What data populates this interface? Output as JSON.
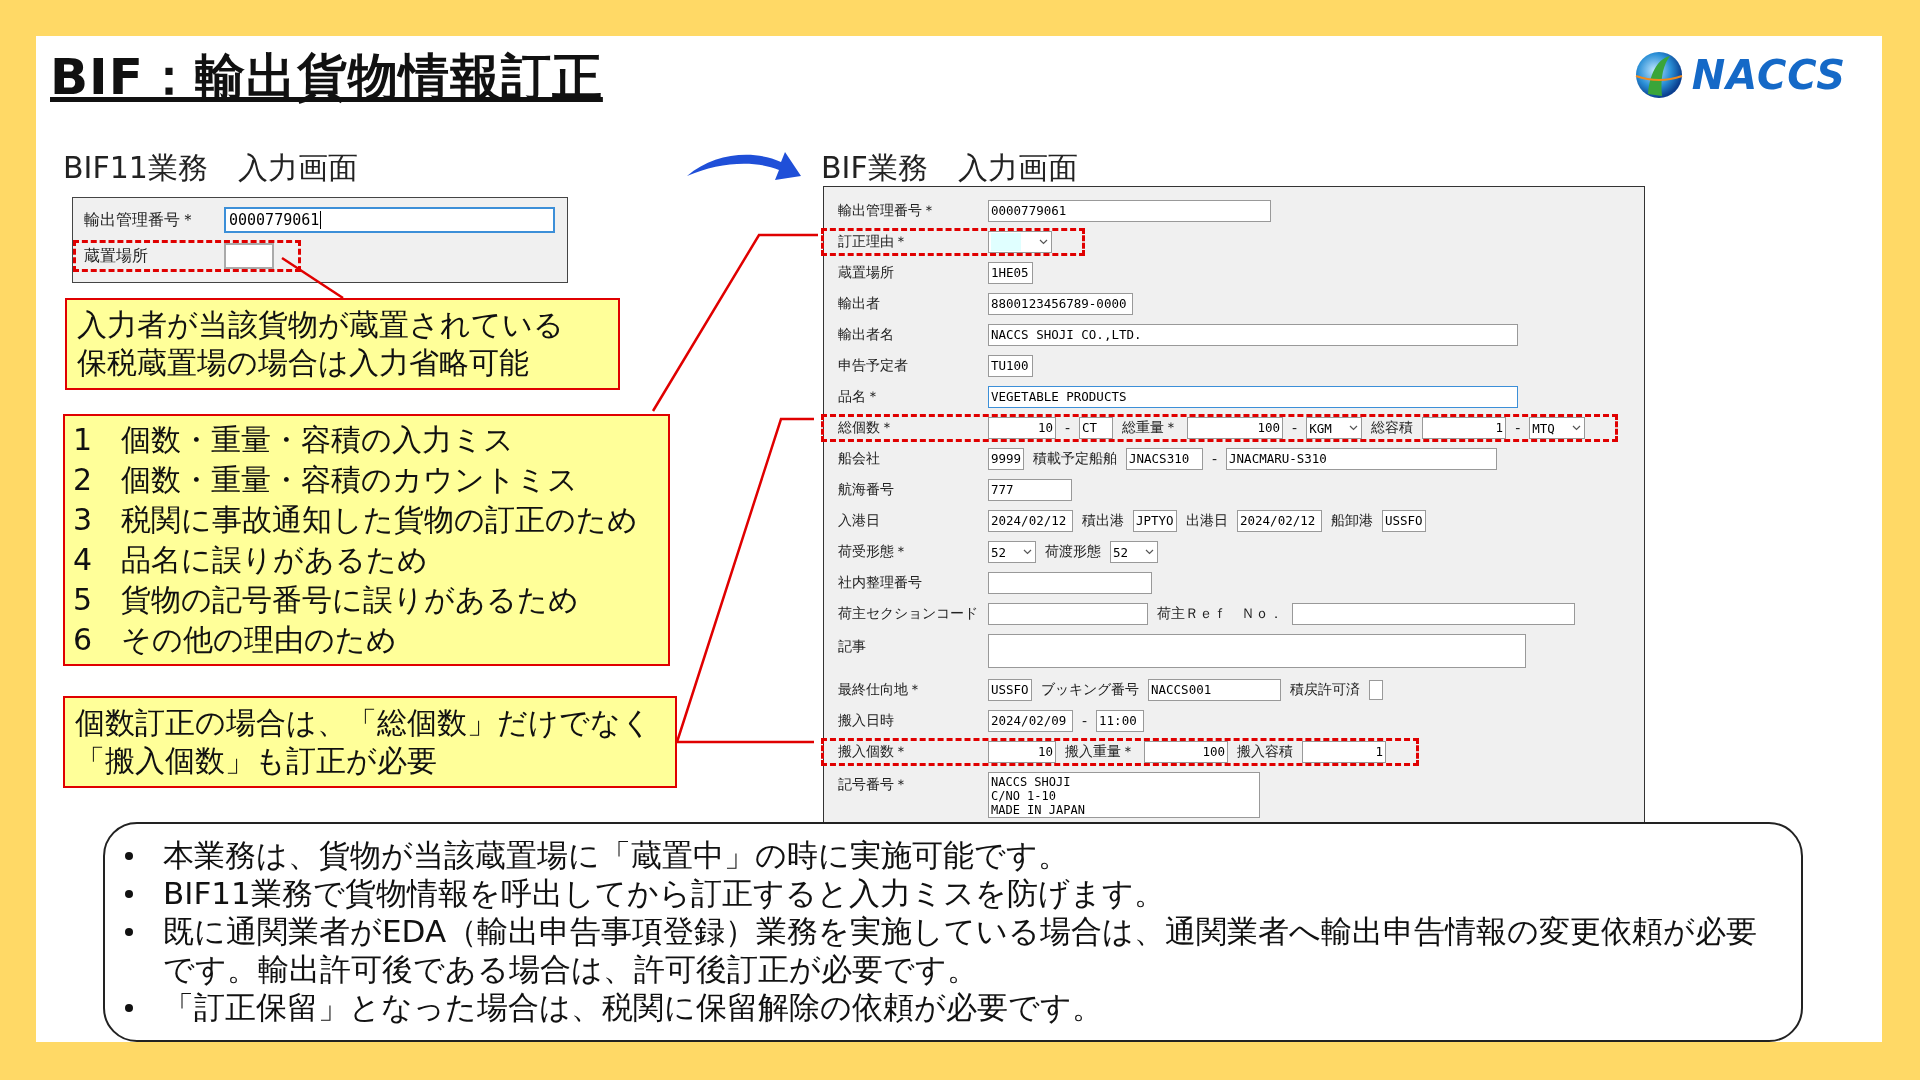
{
  "title": "BIF：輸出貨物情報訂正",
  "logo": {
    "text": "NACCS"
  },
  "old_screen": {
    "heading": "BIF11業務　入力画面",
    "rows": [
      {
        "label": "輸出管理番号＊",
        "value": "0000779061",
        "focused": true,
        "highlighted": false
      },
      {
        "label": "蔵置場所",
        "focused": false,
        "highlighted": true
      }
    ]
  },
  "note_storage": [
    "入力者が当該貨物が蔵置されている",
    "保税蔵置場の場合は入力省略可能"
  ],
  "reasons": [
    {
      "number": "1",
      "text": "個数・重量・容積の入力ミス"
    },
    {
      "number": "2",
      "text": "個数・重量・容積のカウントミス"
    },
    {
      "number": "3",
      "text": "税関に事故通知した貨物の訂正のため"
    },
    {
      "number": "4",
      "text": "品名に誤りがあるため"
    },
    {
      "number": "5",
      "text": "貨物の記号番号に誤りがあるため"
    },
    {
      "number": "6",
      "text": "その他の理由のため"
    }
  ],
  "note_quantity": [
    "個数訂正の場合は、「総個数」だけでなく",
    "「搬入個数」も訂正が必要"
  ],
  "new_screen": {
    "heading": "BIF業務　入力画面",
    "rows": [
      {
        "label": "輸出管理番号＊",
        "highlighted": false,
        "items": [
          {
            "kind": "text",
            "value": "0000779061",
            "focused": false
          }
        ]
      },
      {
        "label": "訂正理由＊",
        "highlighted": true,
        "items": [
          {
            "kind": "select",
            "alert": true
          }
        ]
      },
      {
        "label": "蔵置場所",
        "highlighted": false,
        "items": [
          {
            "kind": "text",
            "value": "1HE05",
            "focused": false
          }
        ]
      },
      {
        "label": "輸出者",
        "highlighted": false,
        "items": [
          {
            "kind": "text",
            "value": "8800123456789-0000",
            "focused": false
          }
        ]
      },
      {
        "label": "輸出者名",
        "highlighted": false,
        "items": [
          {
            "kind": "text",
            "value": "NACCS SHOJI CO.,LTD.",
            "focused": false
          }
        ]
      },
      {
        "label": "申告予定者",
        "highlighted": false,
        "items": [
          {
            "kind": "text",
            "value": "TU100",
            "focused": false
          }
        ]
      },
      {
        "label": "品名＊",
        "highlighted": false,
        "items": [
          {
            "kind": "text",
            "value": "VEGETABLE PRODUCTS",
            "focused": true
          }
        ]
      },
      {
        "label": "総個数＊",
        "highlighted": true,
        "items": [
          {
            "kind": "number",
            "value": "10"
          },
          {
            "kind": "sep",
            "text": "-"
          },
          {
            "kind": "text",
            "value": "CT",
            "focused": false
          },
          {
            "kind": "label",
            "text": "総重量＊"
          },
          {
            "kind": "number",
            "value": "100"
          },
          {
            "kind": "sep",
            "text": "-"
          },
          {
            "kind": "select",
            "value": "KGM"
          },
          {
            "kind": "label",
            "text": "総容積"
          },
          {
            "kind": "number",
            "value": "1"
          },
          {
            "kind": "sep",
            "text": "-"
          },
          {
            "kind": "select",
            "value": "MTQ"
          }
        ]
      },
      {
        "label": "船会社",
        "highlighted": false,
        "items": [
          {
            "kind": "text",
            "value": "9999",
            "focused": false
          },
          {
            "kind": "label",
            "text": "積載予定船舶"
          },
          {
            "kind": "text",
            "value": "JNACS310",
            "focused": false
          },
          {
            "kind": "sep",
            "text": "-"
          },
          {
            "kind": "text",
            "value": "JNACMARU-S310",
            "focused": false
          }
        ]
      },
      {
        "label": "航海番号",
        "highlighted": false,
        "items": [
          {
            "kind": "text",
            "value": "777",
            "focused": false
          }
        ]
      },
      {
        "label": "入港日",
        "highlighted": false,
        "items": [
          {
            "kind": "text",
            "value": "2024/02/12",
            "focused": false
          },
          {
            "kind": "label",
            "text": "積出港"
          },
          {
            "kind": "text",
            "value": "JPTYO",
            "focused": false
          },
          {
            "kind": "label",
            "text": "出港日"
          },
          {
            "kind": "text",
            "value": "2024/02/12",
            "focused": false
          },
          {
            "kind": "label",
            "text": "船卸港"
          },
          {
            "kind": "text",
            "value": "USSFO",
            "focused": false
          }
        ]
      },
      {
        "label": "荷受形態＊",
        "highlighted": false,
        "items": [
          {
            "kind": "select",
            "value": "52"
          },
          {
            "kind": "label",
            "text": "荷渡形態"
          },
          {
            "kind": "select",
            "value": "52"
          }
        ]
      },
      {
        "label": "社内整理番号",
        "highlighted": false,
        "items": [
          {
            "kind": "text",
            "focused": false
          }
        ]
      },
      {
        "label": "荷主セクションコード",
        "highlighted": false,
        "items": [
          {
            "kind": "text",
            "focused": false
          },
          {
            "kind": "label",
            "text": "荷主Ｒｅｆ　Ｎｏ．"
          },
          {
            "kind": "text",
            "focused": false
          }
        ]
      },
      {
        "label": "記事",
        "highlighted": false,
        "items": [
          {
            "kind": "memo"
          }
        ]
      },
      {
        "label": "最終仕向地＊",
        "highlighted": false,
        "items": [
          {
            "kind": "text",
            "value": "USSFO",
            "focused": false
          },
          {
            "kind": "label",
            "text": "ブッキング番号"
          },
          {
            "kind": "text",
            "value": "NACCS001",
            "focused": false
          },
          {
            "kind": "label",
            "text": "積戻許可済"
          },
          {
            "kind": "checkbox",
            "checked": false
          }
        ]
      },
      {
        "label": "搬入日時",
        "highlighted": false,
        "items": [
          {
            "kind": "text",
            "value": "2024/02/09",
            "focused": false
          },
          {
            "kind": "sep",
            "text": "-"
          },
          {
            "kind": "text",
            "value": "11:00",
            "focused": false
          }
        ]
      },
      {
        "label": "搬入個数＊",
        "highlighted": true,
        "items": [
          {
            "kind": "number",
            "value": "10"
          },
          {
            "kind": "label",
            "text": "搬入重量＊"
          },
          {
            "kind": "number",
            "value": "100"
          },
          {
            "kind": "label",
            "text": "搬入容積"
          },
          {
            "kind": "number",
            "value": "1"
          }
        ]
      },
      {
        "label": "記号番号＊",
        "highlighted": false,
        "items": [
          {
            "kind": "memo",
            "value": "NACCS SHOJI\nC/NO 1-10\nMADE IN JAPAN"
          }
        ]
      }
    ]
  },
  "notes": [
    "本業務は、貨物が当該蔵置場に「蔵置中」の時に実施可能です。",
    "BIF11業務で貨物情報を呼出してから訂正すると入力ミスを防げます。",
    "既に通関業者がEDA（輸出申告事項登録）業務を実施している場合は、通関業者へ輸出申告情報の変更依頼が必要です。輸出許可後である場合は、許可後訂正が必要です。",
    "「訂正保留」となった場合は、税関に保留解除の依頼が必要です。"
  ]
}
